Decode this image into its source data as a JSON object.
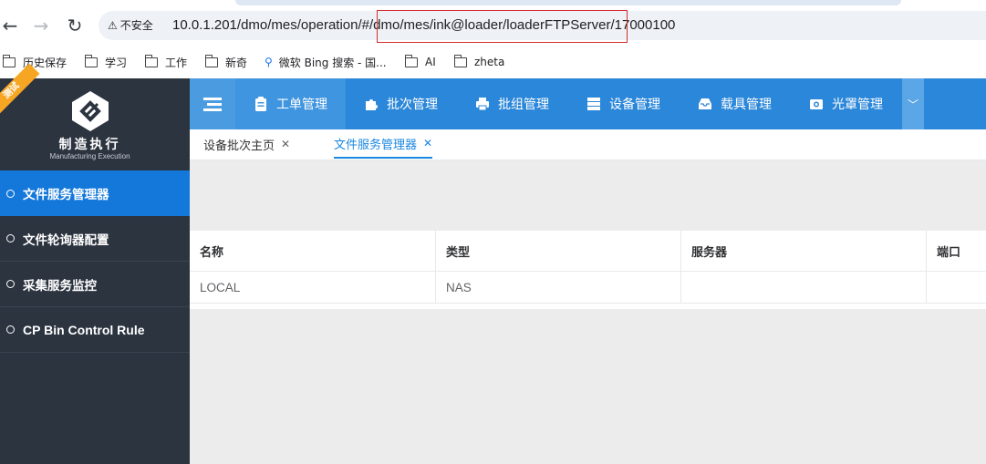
{
  "browser": {
    "security_label": "不安全",
    "url": "10.0.1.201/dmo/mes/operation/#/dmo/mes/ink@loader/loaderFTPServer/17000100",
    "back_icon": "arrow-left-icon",
    "forward_icon": "arrow-right-icon",
    "reload_icon": "reload-icon"
  },
  "bookmarks": [
    {
      "label": "历史保存",
      "icon": "folder-icon"
    },
    {
      "label": "学习",
      "icon": "folder-icon"
    },
    {
      "label": "工作",
      "icon": "folder-icon"
    },
    {
      "label": "新奇",
      "icon": "folder-icon"
    },
    {
      "label": "微软 Bing 搜索 - 国...",
      "icon": "search-icon"
    },
    {
      "label": "AI",
      "icon": "folder-icon"
    },
    {
      "label": "zheta",
      "icon": "folder-icon"
    }
  ],
  "brand": {
    "ribbon": "测试",
    "title": "制造执行",
    "subtitle": "Manufacturing Execution"
  },
  "sidebar": {
    "items": [
      {
        "label": "文件服务管理器",
        "active": true
      },
      {
        "label": "文件轮询器配置",
        "active": false
      },
      {
        "label": "采集服务监控",
        "active": false
      },
      {
        "label": "CP Bin Control Rule",
        "active": false
      }
    ]
  },
  "topnav": {
    "items": [
      {
        "label": "工单管理",
        "icon": "clipboard-icon"
      },
      {
        "label": "批次管理",
        "icon": "puzzle-icon"
      },
      {
        "label": "批组管理",
        "icon": "printer-icon"
      },
      {
        "label": "设备管理",
        "icon": "server-icon"
      },
      {
        "label": "载具管理",
        "icon": "inbox-icon"
      },
      {
        "label": "光罩管理",
        "icon": "camera-icon"
      }
    ]
  },
  "tabs": [
    {
      "label": "设备批次主页",
      "active": false
    },
    {
      "label": "文件服务管理器",
      "active": true
    }
  ],
  "table": {
    "headers": [
      "名称",
      "类型",
      "服务器",
      "端口"
    ],
    "rows": [
      [
        "LOCAL",
        "NAS",
        "",
        ""
      ]
    ]
  },
  "colors": {
    "sidebar_bg": "#2c3440",
    "active_item": "#1478db",
    "topnav_bg": "#2b87d9",
    "tab_active": "#1a87e0",
    "url_highlight_border": "#d32f2f"
  }
}
